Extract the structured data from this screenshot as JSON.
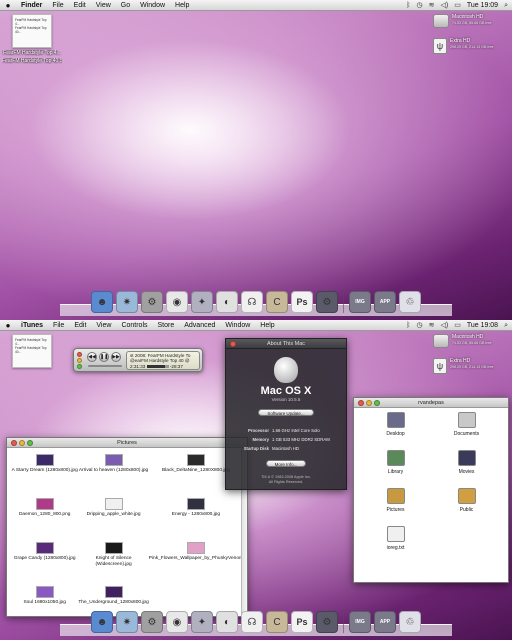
{
  "top": {
    "menubar": {
      "app": "Finder",
      "items": [
        "File",
        "Edit",
        "View",
        "Go",
        "Window",
        "Help"
      ],
      "clock": "Tue 19:09"
    },
    "desktop_file": {
      "doc_lines": [
        "FearFM Hardstyle Top 4...",
        "FearFM Hardstyle Top 40..."
      ],
      "label_lines": [
        "FearFM Hardstyle Top 4...",
        "FearFM Hardstyle Top 40 S..."
      ]
    },
    "drives": [
      {
        "name": "Macintosh HD",
        "info": "74.53 GB, 65.68 GB free"
      },
      {
        "name": "Extra HD",
        "info": "298.09 GB, 214.13 GB free"
      }
    ]
  },
  "bottom": {
    "menubar": {
      "app": "iTunes",
      "items": [
        "File",
        "Edit",
        "View",
        "Controls",
        "Store",
        "Advanced",
        "Window",
        "Help"
      ],
      "clock": "Tue 19:08"
    },
    "mini_player": {
      "line1": "st 2008: FearFM Hardstyle To",
      "line2": "@earFM Hardstyle Top 40 @",
      "elapsed": "2:31:33",
      "remaining": "-28:37",
      "progress": 0.84
    },
    "about": {
      "title": "About This Mac",
      "os": "Mac OS X",
      "version": "Version 10.5.5",
      "update_button": "Software Update...",
      "specs": [
        {
          "k": "Processor",
          "v": "1.66 GHz Intel Core Solo"
        },
        {
          "k": "Memory",
          "v": "1 GB 533 MHz DDR2 SDRAM"
        },
        {
          "k": "Startup Disk",
          "v": "Macintosh HD"
        }
      ],
      "more_button": "More Info...",
      "copyright1": "TM & © 1983-2008 Apple Inc.",
      "copyright2": "All Rights Reserved."
    },
    "pictures": {
      "title": "Pictures",
      "items": [
        {
          "name": "A Starry Dream (1280x800).jpg",
          "color": "#3a2a6a"
        },
        {
          "name": "Arrival to heaven (1280x800).jpg",
          "color": "#7a5cb0"
        },
        {
          "name": "Black_DeltaNine_1280X800.jpg",
          "color": "#2a2a2a"
        },
        {
          "name": "Daemon_1280_800.png",
          "color": "#b03a8a"
        },
        {
          "name": "Dripping_apple_white.jpg",
          "color": "#f0f0f0"
        },
        {
          "name": "Energy - 1280x800.jpg",
          "color": "#303040"
        },
        {
          "name": "Grape Candy (1280x800).jpg",
          "color": "#5a2a7a"
        },
        {
          "name": "Knight of Silence (Widescreen).jpg",
          "color": "#1a1a1a"
        },
        {
          "name": "Pink_Flowers_Wallpaper_by_PhunkyVenom",
          "color": "#e0a0c8"
        },
        {
          "name": "Soul 1680x1050.jpg",
          "color": "#8a5ac0"
        },
        {
          "name": "The_Underground_1280x800.jpg",
          "color": "#402060"
        }
      ]
    },
    "finder": {
      "title": "rvandepas",
      "items": [
        {
          "name": "Desktop",
          "color": "#6a6a8a"
        },
        {
          "name": "Documents",
          "color": "#c8c8c8"
        },
        {
          "name": "Library",
          "color": "#5a8a5a"
        },
        {
          "name": "Movies",
          "color": "#3a3a5a"
        },
        {
          "name": "Pictures",
          "color": "#c89a40"
        },
        {
          "name": "Public",
          "color": "#d0a040"
        },
        {
          "name": "ioreg.txt",
          "color": "#f0f0f0"
        }
      ]
    }
  },
  "dock": [
    {
      "name": "finder-icon",
      "glyph": "☻",
      "color": "#5a8ad0"
    },
    {
      "name": "safari-icon",
      "glyph": "✷",
      "color": "#9ab8d8"
    },
    {
      "name": "system-preferences-icon",
      "glyph": "⚙",
      "color": "#a0a0a0"
    },
    {
      "name": "robot-icon",
      "glyph": "◉",
      "color": "#e8e8e8"
    },
    {
      "name": "compass-icon",
      "glyph": "✦",
      "color": "#b0b0c0"
    },
    {
      "name": "camera-icon",
      "glyph": "◐",
      "color": "#e0e0e0"
    },
    {
      "name": "headphones-icon",
      "glyph": "☊",
      "color": "#f0f0f0"
    },
    {
      "name": "coda-icon",
      "glyph": "C",
      "color": "#c8b89a"
    },
    {
      "name": "photoshop-icon",
      "glyph": "Ps",
      "color": "#f2f2f2"
    },
    {
      "name": "utility-icon",
      "glyph": "⚙",
      "color": "#5a5a6a"
    },
    {
      "name": "images-folder-icon",
      "glyph": "IMG",
      "color": "#7a7a8a"
    },
    {
      "name": "apps-folder-icon",
      "glyph": "APP",
      "color": "#7a7a8a"
    },
    {
      "name": "trash-icon",
      "glyph": "♲",
      "color": "#e0e0e8"
    }
  ],
  "dock_labels": {
    "images": "IMAGES",
    "apps": "APPS"
  }
}
